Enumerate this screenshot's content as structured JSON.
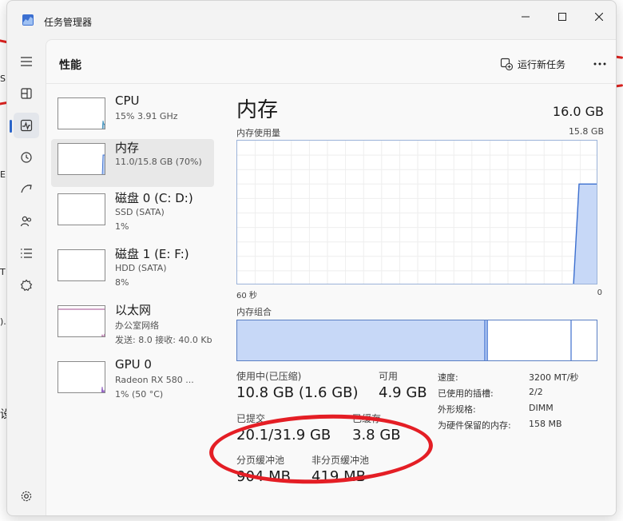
{
  "window": {
    "title": "任务管理器"
  },
  "background": {
    "fragments": [
      "S",
      "E",
      "T",
      ").",
      "设"
    ]
  },
  "header": {
    "page_title": "性能",
    "run_new_task": "运行新任务"
  },
  "sidebar": {
    "items": [
      "menu-icon",
      "processes-icon",
      "performance-icon",
      "app-history-icon",
      "startup-apps-icon",
      "users-icon",
      "details-icon",
      "services-icon"
    ],
    "footer": "settings-icon",
    "active_index": 2
  },
  "devices": [
    {
      "name": "CPU",
      "sub1": "15% 3.91 GHz",
      "sub2": ""
    },
    {
      "name": "内存",
      "sub1": "11.0/15.8 GB (70%)",
      "sub2": ""
    },
    {
      "name": "磁盘 0 (C: D:)",
      "sub1": "SSD (SATA)",
      "sub2": "1%"
    },
    {
      "name": "磁盘 1 (E: F:)",
      "sub1": "HDD (SATA)",
      "sub2": "8%"
    },
    {
      "name": "以太网",
      "sub1": "办公室网络",
      "sub2": "发送: 8.0  接收: 40.0 Kb"
    },
    {
      "name": "GPU 0",
      "sub1": "Radeon RX 580 ...",
      "sub2": "1% (50 °C)"
    }
  ],
  "memory": {
    "title": "内存",
    "total": "16.0 GB",
    "usage_label": "内存使用量",
    "max_label": "15.8 GB",
    "time_left": "60 秒",
    "time_right": "0",
    "composition_label": "内存组合",
    "usage_fraction": 0.7,
    "stats": {
      "in_use_label": "使用中(已压缩)",
      "in_use_value": "10.8 GB (1.6 GB)",
      "available_label": "可用",
      "available_value": "4.9 GB",
      "committed_label": "已提交",
      "committed_value": "20.1/31.9 GB",
      "cached_label": "已缓存",
      "cached_value": "3.8 GB",
      "paged_label": "分页缓冲池",
      "paged_value": "904 MB",
      "nonpaged_label": "非分页缓冲池",
      "nonpaged_value": "419 MB"
    },
    "specs": [
      {
        "label": "速度:",
        "value": "3200 MT/秒"
      },
      {
        "label": "已使用的插槽:",
        "value": "2/2"
      },
      {
        "label": "外形规格:",
        "value": "DIMM"
      },
      {
        "label": "为硬件保留的内存:",
        "value": "158 MB"
      }
    ]
  },
  "colors": {
    "accent": "#2b65c9",
    "memory_line": "#3c6fcf",
    "memory_fill": "#c7d8f7",
    "annotation": "#e41e25"
  }
}
